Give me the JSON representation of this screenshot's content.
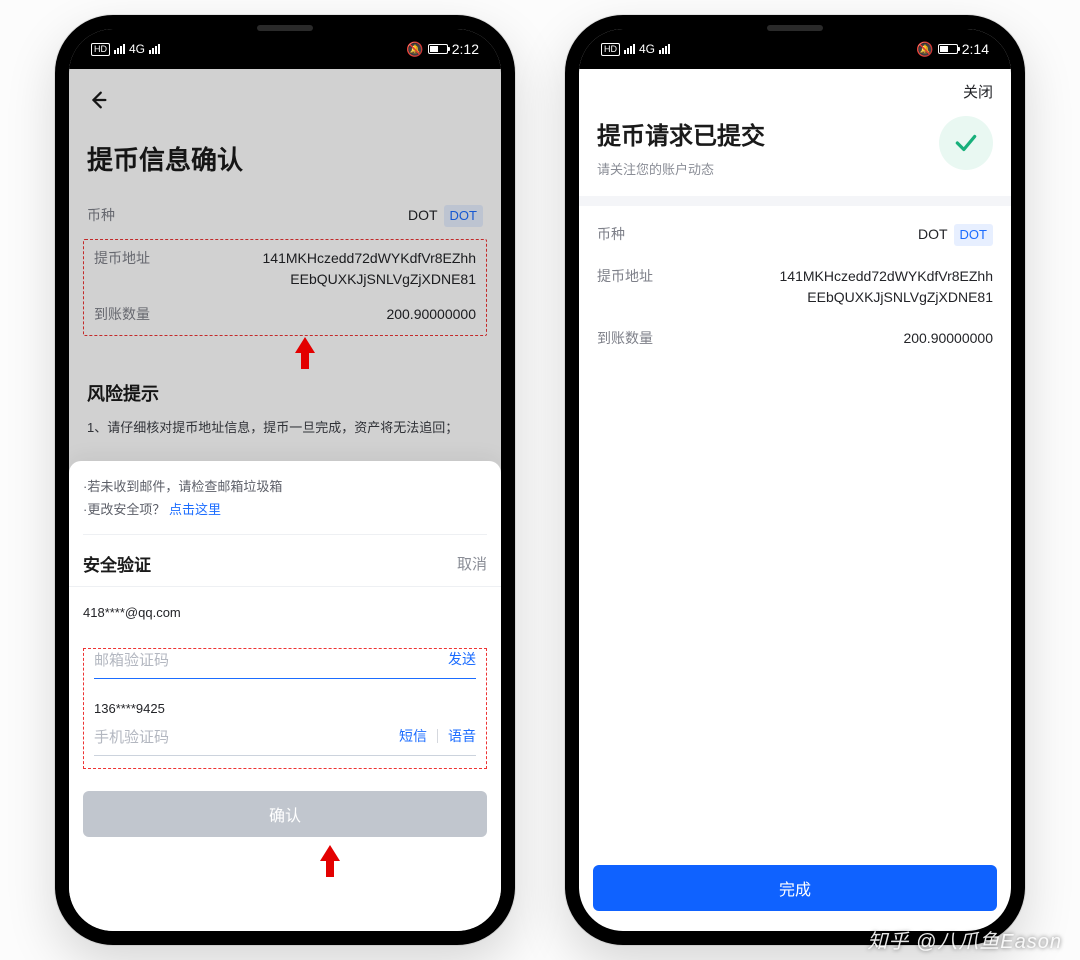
{
  "status_left": {
    "hd": "HD",
    "net": "4G",
    "net2": "4G",
    "time": "2:12",
    "bell_glyph": "🔕"
  },
  "status_right": {
    "hd": "HD",
    "net": "4G",
    "net2": "4G",
    "time": "2:14",
    "bell_glyph": "🔕"
  },
  "left": {
    "title": "提币信息确认",
    "coin_label": "币种",
    "coin_value": "DOT",
    "coin_badge": "DOT",
    "addr_label": "提币地址",
    "addr_line1": "141MKHczedd72dWYKdfVr8EZhh",
    "addr_line2": "EEbQUXKJjSNLVgZjXDNE81",
    "amount_label": "到账数量",
    "amount_value": "200.90000000",
    "risk_title": "风险提示",
    "risk_text": "1、请仔细核对提币地址信息，提币一旦完成，资产将无法追回；",
    "sheet": {
      "tip1": "·若未收到邮件，请检查邮箱垃圾箱",
      "tip2_prefix": "·更改安全项？",
      "tip2_link": "点击这里",
      "title": "安全验证",
      "cancel": "取消",
      "email": "418****@qq.com",
      "email_ph": "邮箱验证码",
      "send": "发送",
      "phone": "136****9425",
      "phone_ph": "手机验证码",
      "sms": "短信",
      "voice": "语音",
      "confirm": "确认"
    }
  },
  "right": {
    "close": "关闭",
    "title": "提币请求已提交",
    "subtitle": "请关注您的账户动态",
    "coin_label": "币种",
    "coin_value": "DOT",
    "coin_badge": "DOT",
    "addr_label": "提币地址",
    "addr_line1": "141MKHczedd72dWYKdfVr8EZhh",
    "addr_line2": "EEbQUXKJjSNLVgZjXDNE81",
    "amount_label": "到账数量",
    "amount_value": "200.90000000",
    "done": "完成"
  },
  "watermark": "知乎 @八爪鱼Eason"
}
